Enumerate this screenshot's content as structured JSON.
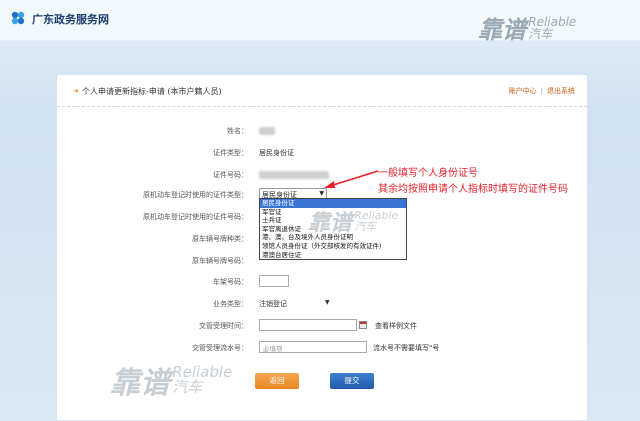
{
  "header": {
    "site_title": "广东政务服务网"
  },
  "watermark": {
    "zh": "靠谱",
    "en": "Reliable",
    "car": "汽车"
  },
  "panel": {
    "title": "个人申请更新指标-申请 (本市户籍人员)",
    "links": {
      "user_center": "账户中心",
      "separator": "|",
      "logout": "退出系统"
    }
  },
  "form": {
    "name_label": "姓名：",
    "id_type_label": "证件类型：",
    "id_type_value": "居民身份证",
    "id_number_label": "证件号码：",
    "orig_reg_id_type_label": "原机动车登记时使用的证件类型：",
    "orig_reg_id_type_value": "居民身份证",
    "orig_reg_id_number_label": "原机动车登记时使用的证件号码：",
    "orig_plate_type_label": "原车辆号牌种类：",
    "orig_plate_number_label": "原车辆号牌号码：",
    "vin_label": "车架号码：",
    "business_type_label": "业务类型：",
    "business_type_value": "注销登记",
    "accept_time_label": "交管受理时间：",
    "sample_link": "查看样例文件",
    "serial_label": "交管受理流水号：",
    "serial_placeholder": "必填项",
    "serial_note": "流水号不需要填写\"号"
  },
  "dropdown": {
    "options": [
      "居民身份证",
      "军官证",
      "士兵证",
      "军官离退休证",
      "港、澳、台及境外人员身份证明",
      "领馆人员身份证（外交部核发的有效证件）",
      "港澳台居住证"
    ],
    "selected_index": 0
  },
  "annotation": {
    "line1": "一般填写个人身份证号",
    "line2": "其余均按照申请个人指标时填写的证件号码",
    "color": "#e8202a"
  },
  "buttons": {
    "back": "返回",
    "submit": "提交"
  }
}
